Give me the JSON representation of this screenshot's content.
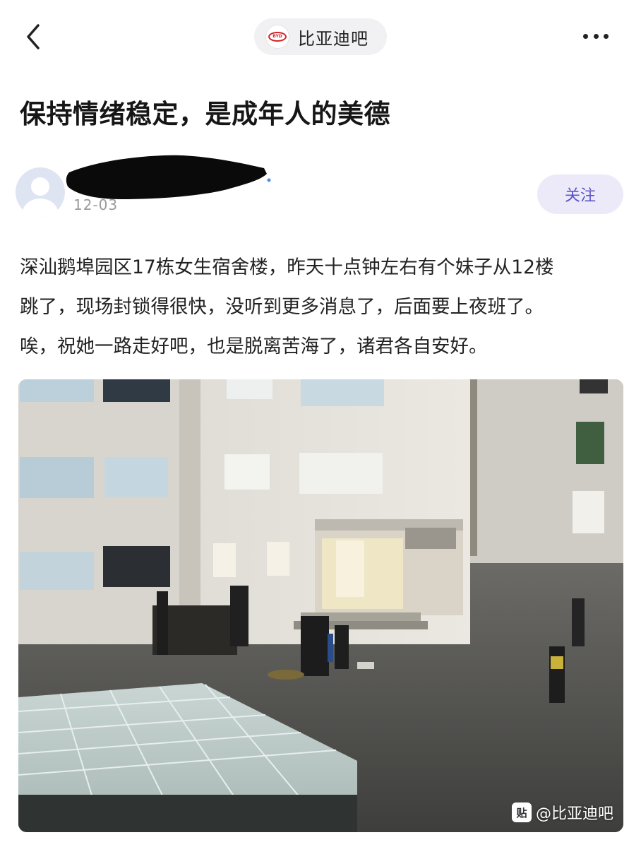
{
  "nav": {
    "back_icon": "chevron-left-icon",
    "forum_name": "比亚迪吧",
    "forum_logo_text": "BYD",
    "more_icon": "more-dots-icon"
  },
  "post": {
    "title": "保持情绪稳定，是成年人的美德",
    "author": {
      "date": "12-03",
      "follow_label": "关注"
    },
    "body_lines": [
      "深汕鹅埠园区17栋女生宿舍楼，昨天十点钟左右有个妹子从12楼",
      "跳了，现场封锁得很快，没听到更多消息了，后面要上夜班了。",
      "唉，祝她一路走好吧，也是脱离苦海了，诸君各自安好。"
    ],
    "image": {
      "watermark_icon_text": "贴",
      "watermark_text": "@比亚迪吧"
    }
  },
  "colors": {
    "accent": "#5b54c9",
    "follow_bg": "#eceaf9",
    "pill_bg": "#f1f1f4",
    "brand_red": "#d4232c"
  }
}
